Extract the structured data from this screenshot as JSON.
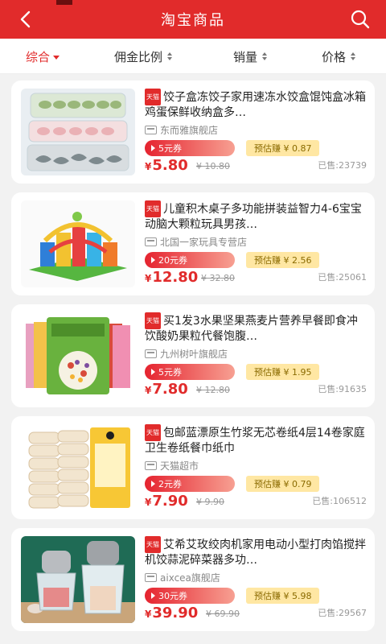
{
  "header": {
    "title": "淘宝商品"
  },
  "sort": {
    "items": [
      {
        "label": "综合",
        "active": true
      },
      {
        "label": "佣金比例",
        "active": false
      },
      {
        "label": "销量",
        "active": false
      },
      {
        "label": "价格",
        "active": false
      }
    ]
  },
  "products": [
    {
      "badge": "天猫",
      "title": "饺子盒冻饺子家用速冻水饺盒馄饨盒冰箱鸡蛋保鲜收纳盒多…",
      "shop": "东而雅旗舰店",
      "coupon": "5元券",
      "earn": "预估赚 ¥ 0.87",
      "price_symbol": "¥",
      "price": "5.80",
      "orig_price": "¥ 10.80",
      "sold": "已售:23739"
    },
    {
      "badge": "天猫",
      "title": "儿童积木桌子多功能拼装益智力4-6宝宝动脑大颗粒玩具男孩…",
      "shop": "北国一家玩具专营店",
      "coupon": "20元券",
      "earn": "预估赚 ¥ 2.56",
      "price_symbol": "¥",
      "price": "12.80",
      "orig_price": "¥ 32.80",
      "sold": "已售:25061"
    },
    {
      "badge": "天猫",
      "title": "买1发3水果坚果燕麦片营养早餐即食冲饮酸奶果粒代餐饱腹…",
      "shop": "九州树叶旗舰店",
      "coupon": "5元券",
      "earn": "预估赚 ¥ 1.95",
      "price_symbol": "¥",
      "price": "7.80",
      "orig_price": "¥ 12.80",
      "sold": "已售:91635"
    },
    {
      "badge": "天猫",
      "title": "包邮蓝漂原生竹浆无芯卷纸4层14卷家庭卫生卷纸餐巾纸巾",
      "shop": "天猫超市",
      "coupon": "2元券",
      "earn": "预估赚 ¥ 0.79",
      "price_symbol": "¥",
      "price": "7.90",
      "orig_price": "¥ 9.90",
      "sold": "已售:106512"
    },
    {
      "badge": "天猫",
      "title": "艾希艾玫绞肉机家用电动小型打肉馅搅拌机饺蒜泥碎菜器多功…",
      "shop": "aixcea旗舰店",
      "coupon": "30元券",
      "earn": "预估赚 ¥ 5.98",
      "price_symbol": "¥",
      "price": "39.90",
      "orig_price": "¥ 69.90",
      "sold": "已售:29567"
    }
  ],
  "colors": {
    "brand": "#e12b2b",
    "earn_bg": "#ffe7a3"
  }
}
